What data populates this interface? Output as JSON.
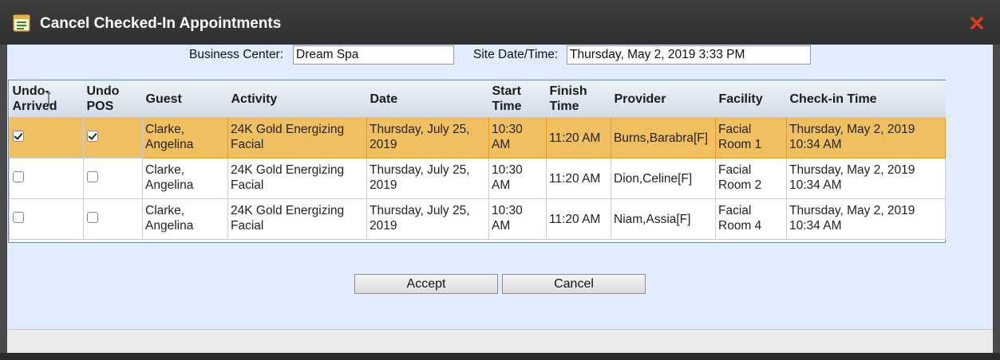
{
  "dialog": {
    "title": "Cancel Checked-In Appointments",
    "title_icon": "list-window-icon",
    "close_icon": "close-x-icon",
    "accent_close": "#e23b1c"
  },
  "form": {
    "business_center_label": "Business Center:",
    "business_center_value": "Dream Spa",
    "site_datetime_label": "Site Date/Time:",
    "site_datetime_value": "Thursday, May 2, 2019 3:33 PM"
  },
  "table": {
    "headers": {
      "undo_arrived": "Undo-Arrived",
      "undo_pos": "Undo POS",
      "guest": "Guest",
      "activity": "Activity",
      "date": "Date",
      "start_time": "Start Time",
      "finish_time": "Finish Time",
      "provider": "Provider",
      "facility": "Facility",
      "checkin_time": "Check-in Time"
    },
    "rows": [
      {
        "undo_arrived": true,
        "undo_pos": true,
        "selected": true,
        "guest": "Clarke, Angelina",
        "activity": "24K Gold Energizing Facial",
        "date": "Thursday, July 25, 2019",
        "start_time": "10:30 AM",
        "finish_time": "11:20 AM",
        "provider": "Burns,Barabra[F]",
        "facility": "Facial Room 1",
        "checkin_time": "Thursday, May 2, 2019 10:34 AM"
      },
      {
        "undo_arrived": false,
        "undo_pos": false,
        "selected": false,
        "guest": "Clarke, Angelina",
        "activity": "24K Gold Energizing Facial",
        "date": "Thursday, July 25, 2019",
        "start_time": "10:30 AM",
        "finish_time": "11:20 AM",
        "provider": "Dion,Celine[F]",
        "facility": "Facial Room 2",
        "checkin_time": "Thursday, May 2, 2019 10:34 AM"
      },
      {
        "undo_arrived": false,
        "undo_pos": false,
        "selected": false,
        "guest": "Clarke, Angelina",
        "activity": "24K Gold Energizing Facial",
        "date": "Thursday, July 25, 2019",
        "start_time": "10:30 AM",
        "finish_time": "11:20 AM",
        "provider": "Niam,Assia[F]",
        "facility": "Facial Room 4",
        "checkin_time": "Thursday, May 2, 2019 10:34 AM"
      }
    ]
  },
  "buttons": {
    "accept": "Accept",
    "cancel": "Cancel"
  },
  "colors": {
    "selected_row": "#f0c060",
    "content_bg": "#e1ecff",
    "titlebar_bg": "#333333"
  }
}
